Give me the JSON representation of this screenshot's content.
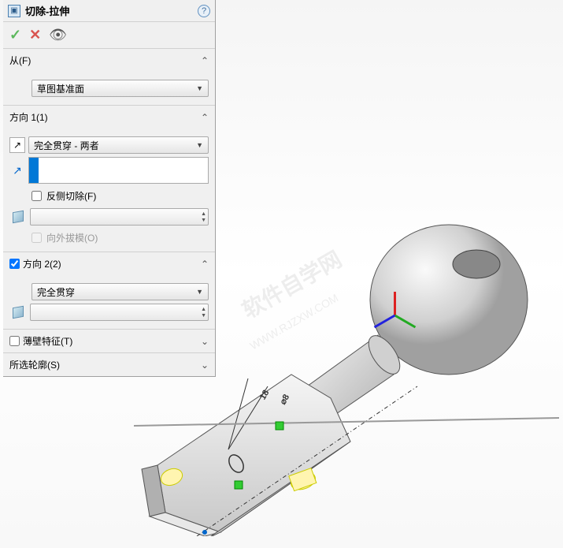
{
  "panel": {
    "title": "切除-拉伸",
    "help_symbol": "?"
  },
  "actions": {
    "ok": "✓",
    "cancel": "✕",
    "preview": "👁"
  },
  "sections": {
    "from": {
      "label": "从(F)",
      "plane_option": "草图基准面"
    },
    "direction1": {
      "label": "方向 1(1)",
      "end_condition": "完全贯穿 - 两者",
      "flip_side_label": "反侧切除(F)",
      "flip_side_checked": false,
      "draft_outward_label": "向外拔模(O)",
      "draft_outward_checked": false
    },
    "direction2": {
      "label": "方向 2(2)",
      "checked": true,
      "end_condition": "完全贯穿"
    },
    "thin_feature": {
      "label": "薄壁特征(T)",
      "checked": false
    },
    "selected_contours": {
      "label": "所选轮廓(S)"
    }
  },
  "watermark": {
    "main": "软件自学网",
    "sub": "WWW.RJZXW.COM"
  },
  "dimensions": {
    "dim1": "18",
    "dim2": "⌀8"
  }
}
